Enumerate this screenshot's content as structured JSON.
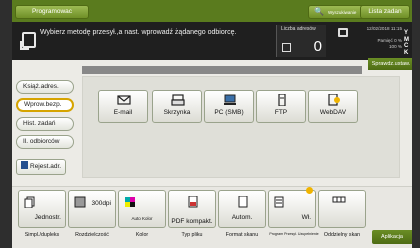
{
  "topbar": {
    "program_label": "Programowac",
    "search_label": "Wyszukiwanie",
    "task_label": "Lista zadan"
  },
  "header": {
    "message": "Wybierz metodę przesył.,a nast. wprowadź żądanego odbiorcę.",
    "counter_label": "Liczba adresów",
    "counter_value": "0",
    "datetime": "12/02/2018 11:15",
    "pamiec_label": "Pamięć",
    "pamiec_value": "0 %",
    "toner_value": "100 %",
    "toner_colors": [
      "Y",
      "M",
      "C"
    ],
    "toner_k": "K"
  },
  "sprawdz_label": "Sprawdz.ustaw.",
  "left_tabs": [
    {
      "label": "Książ.adres."
    },
    {
      "label": "Wprow.bezp."
    },
    {
      "label": "Hist. zadań"
    },
    {
      "label": "Il. odbiorców"
    }
  ],
  "rejestr_label": "Rejest.adr.",
  "destinations": [
    {
      "label": "E-mail",
      "icon": "envelope-icon"
    },
    {
      "label": "Skrzynka",
      "icon": "inbox-icon"
    },
    {
      "label": "PC (SMB)",
      "icon": "computer-icon"
    },
    {
      "label": "FTP",
      "icon": "server-icon"
    },
    {
      "label": "WebDAV",
      "icon": "webdav-icon"
    }
  ],
  "bottom_buttons": [
    {
      "value": "Jednostr.",
      "caption": "Simpl./dupleks"
    },
    {
      "value": "300dpi",
      "caption": "Rozdzielczość"
    },
    {
      "value": "Auto Kolor",
      "caption": "Kolor"
    },
    {
      "value": "PDF kompakt.",
      "caption": "Typ pliku"
    },
    {
      "value": "Autom.",
      "caption": "Format skanu"
    },
    {
      "value": "Wł.",
      "caption": "Program Przesył. Uzupełnienie"
    },
    {
      "value": "",
      "caption": "Oddzielny skan"
    }
  ],
  "aplikacja_label": "Aplikacja",
  "accent_green": "#5a7b1e",
  "active_tab_color": "#d6a400"
}
